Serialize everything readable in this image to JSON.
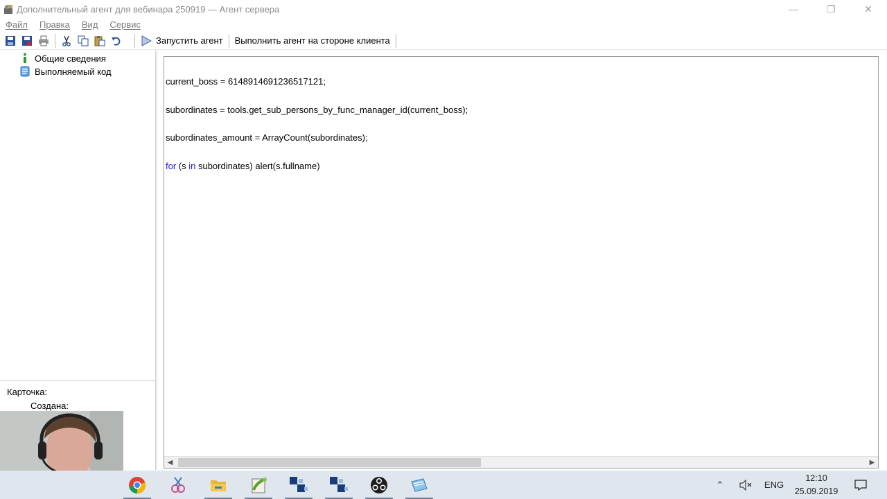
{
  "window": {
    "title": "Дополнительный агент для вебинара 250919 — Агент сервера",
    "minimize": "—",
    "restore": "❐",
    "close": "✕"
  },
  "menu": {
    "items": [
      {
        "label": "Файл"
      },
      {
        "label": "Правка"
      },
      {
        "label": "Вид"
      },
      {
        "label": "Сервис"
      }
    ]
  },
  "toolbar": {
    "run_agent": "Запустить агент",
    "run_client_side": "Выполнить агент на стороне клиента"
  },
  "tree": {
    "items": [
      {
        "label": "Общие сведения",
        "icon": "info-icon"
      },
      {
        "label": "Выполняемый код",
        "icon": "code-page-icon"
      }
    ]
  },
  "card": {
    "card_label": "Карточка:",
    "created_label": "Создана:"
  },
  "editor": {
    "lines": [
      "current_boss = 6148914691236517121;",
      "subordinates = tools.get_sub_persons_by_func_manager_id(current_boss);",
      "subordinates_amount = ArrayCount(subordinates);"
    ],
    "line4_kw1": "for",
    "line4_mid": " (s ",
    "line4_kw2": "in",
    "line4_rest": " subordinates) alert(s.fullname)"
  },
  "taskbar": {
    "apps": [
      "chrome-icon",
      "snipping-icon",
      "explorer-icon",
      "notepadpp-icon",
      "app-blue-icon-1",
      "app-blue-icon-2",
      "obs-icon",
      "notes-icon"
    ],
    "language": "ENG",
    "time": "12:10",
    "date": "25.09.2019"
  },
  "colors": {
    "keyword": "#2222cc",
    "taskbar_bg": "#dfe6ee",
    "title_text": "#8a8a8a"
  }
}
